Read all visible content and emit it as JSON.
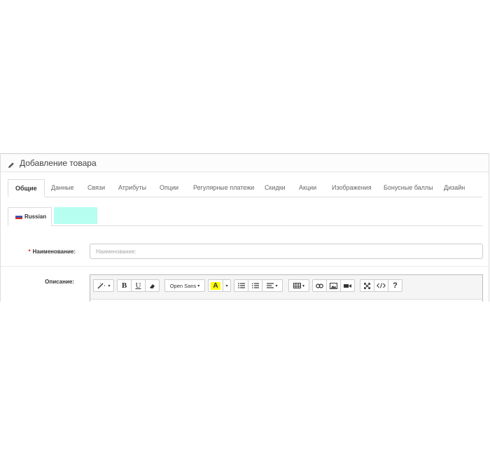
{
  "panel": {
    "title": "Добавление товара"
  },
  "tabs": [
    {
      "label": "Общие"
    },
    {
      "label": "Данные"
    },
    {
      "label": "Связи"
    },
    {
      "label": "Атрибуты"
    },
    {
      "label": "Опции"
    },
    {
      "label": "Регулярные платежи"
    },
    {
      "label": "Скидки"
    },
    {
      "label": "Акции"
    },
    {
      "label": "Изображения"
    },
    {
      "label": "Бонусные баллы"
    },
    {
      "label": "Дизайн"
    }
  ],
  "language_tabs": [
    {
      "label": "Russian",
      "icon": "russia-flag-icon"
    }
  ],
  "form": {
    "name_label": "Наименование:",
    "name_required_mark": "*",
    "name_placeholder": "Наименование:",
    "description_label": "Описание:"
  },
  "editor_toolbar": {
    "font_name": "Open Sans",
    "highlight_letter": "A",
    "bold": "B",
    "underline": "U",
    "help": "?",
    "highlight_color": "#ffff00"
  }
}
